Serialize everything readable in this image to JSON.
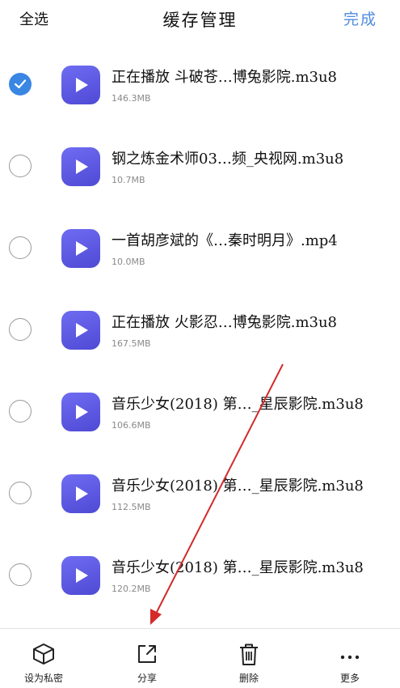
{
  "header": {
    "select_all": "全选",
    "title": "缓存管理",
    "done": "完成"
  },
  "files": [
    {
      "name": "正在播放 斗破苍…博兔影院.m3u8",
      "size": "146.3MB",
      "checked": true
    },
    {
      "name": "钢之炼金术师03…频_央视网.m3u8",
      "size": "10.7MB",
      "checked": false
    },
    {
      "name": "一首胡彦斌的《…秦时明月》.mp4",
      "size": "10.0MB",
      "checked": false
    },
    {
      "name": "正在播放 火影忍…博兔影院.m3u8",
      "size": "167.5MB",
      "checked": false
    },
    {
      "name": "音乐少女(2018) 第…_星辰影院.m3u8",
      "size": "106.6MB",
      "checked": false
    },
    {
      "name": "音乐少女(2018) 第…_星辰影院.m3u8",
      "size": "112.5MB",
      "checked": false
    },
    {
      "name": "音乐少女(2018) 第…_星辰影院.m3u8",
      "size": "120.2MB",
      "checked": false
    }
  ],
  "toolbar": {
    "private": {
      "label": "设为私密",
      "icon": "box-icon"
    },
    "share": {
      "label": "分享",
      "icon": "share-icon"
    },
    "delete": {
      "label": "删除",
      "icon": "trash-icon"
    },
    "more": {
      "label": "更多",
      "icon": "more-icon"
    }
  },
  "colors": {
    "accent": "#4f8be0",
    "check": "#3a86e3",
    "thumb": "#5c57e0",
    "annotation_arrow": "#d42a2a"
  }
}
